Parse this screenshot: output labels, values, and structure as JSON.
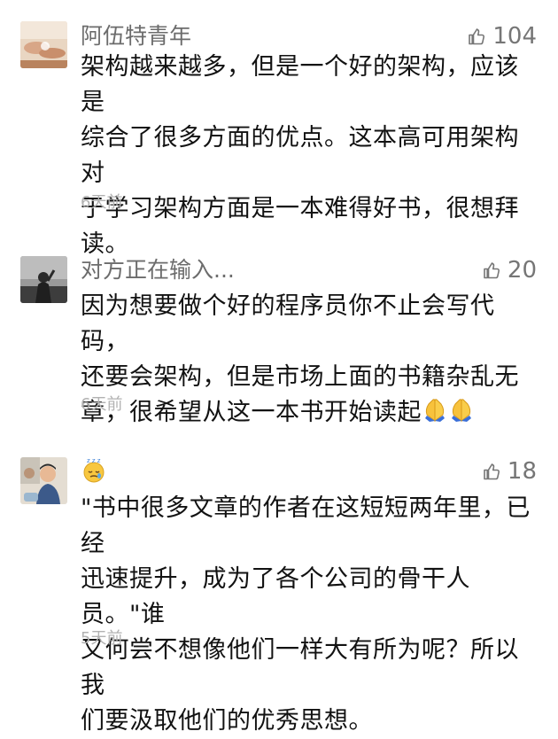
{
  "comments": [
    {
      "name": "阿伍特青年",
      "likes": "104",
      "text": "架构越来越多，但是一个好的架构，应该是\n综合了很多方面的优点。这本高可用架构对\n于学习架构方面是一本难得好书，很想拜\n读。",
      "time": "6天前"
    },
    {
      "name": "对方正在输入...",
      "likes": "20",
      "text": "因为想要做个好的程序员你不止会写代码，\n还要会架构，但是市场上面的书籍杂乱无\n章，很希望从这一本书开始读起",
      "time": "6天前",
      "trailing_emoji": "folded-hands-emoji"
    },
    {
      "name_emoji": "sleepy-face-emoji",
      "likes": "18",
      "text": "\"书中很多文章的作者在这短短两年里，已经\n迅速提升，成为了各个公司的骨干人员。\"谁\n又何尝不想像他们一样大有所为呢？所以我\n们要汲取他们的优秀思想。",
      "time": "5天前"
    }
  ],
  "colors": {
    "name": "#6c6c6c",
    "like": "#767676",
    "time": "#b2b2b2",
    "text": "#121212"
  }
}
